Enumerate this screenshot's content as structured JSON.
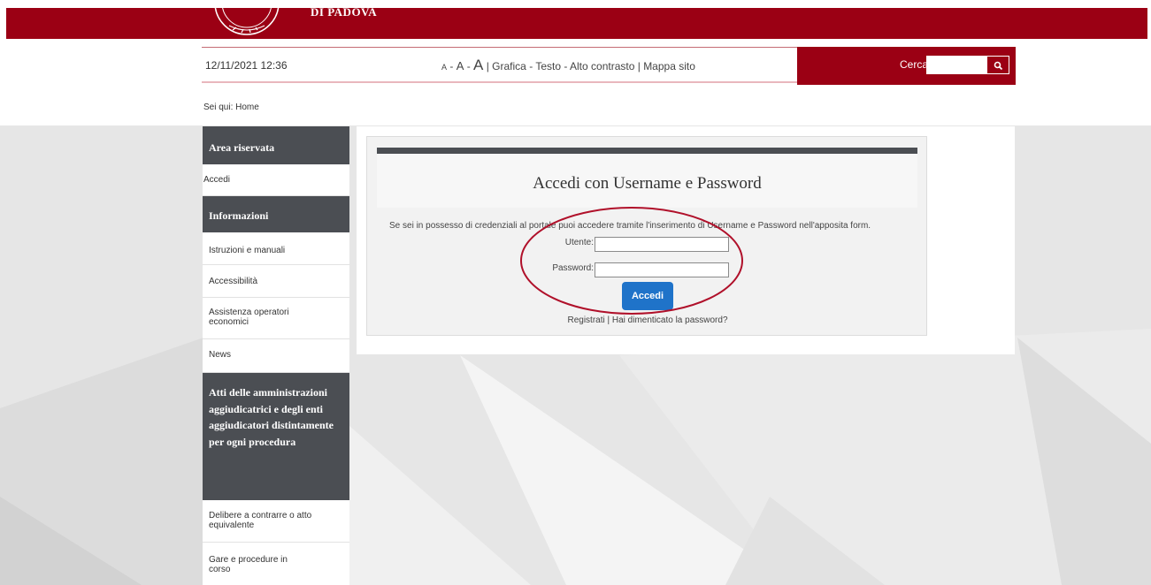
{
  "banner": {
    "logo_text": "DI PADOVA",
    "bg_color": "#9b0014"
  },
  "utility_bar": {
    "datetime": "12/11/2021 12:36",
    "font_small": "A",
    "sep1": " - ",
    "font_medium": "A",
    "sep2": " - ",
    "font_large": "A",
    "sep3": " | ",
    "grafica": "Grafica",
    "sep4": " - ",
    "testo": "Testo",
    "sep5": " - ",
    "alto_contrasto": "Alto contrasto",
    "sep6": " | ",
    "mappa_sito": "Mappa sito",
    "search_label": "Cerca:",
    "search_value": "",
    "search_icon": "search-icon"
  },
  "breadcrumb": {
    "prefix": "Sei qui:",
    "current": "Home"
  },
  "sidebar": {
    "sections": [
      {
        "title": "Area riservata",
        "items": [
          "Accedi"
        ]
      },
      {
        "title": "Informazioni",
        "items": [
          "Istruzioni e manuali",
          "Accessibilità",
          "Assistenza operatori economici",
          "News"
        ]
      },
      {
        "title": "Atti delle amministrazioni aggiudicatrici e degli enti aggiudicatori distintamente per ogni procedura",
        "items": [
          "Delibere a contrarre o atto equivalente",
          "Gare e procedure in corso"
        ]
      }
    ]
  },
  "login": {
    "title": "Accedi con Username e Password",
    "description": "Se sei in possesso di credenziali al portale puoi accedere tramite l'inserimento di Username e Password nell'apposita form.",
    "username_label": "Utente:",
    "username_value": "",
    "password_label": "Password:",
    "password_value": "",
    "submit_label": "Accedi",
    "register_link": "Registrati",
    "links_separator": " | ",
    "forgot_link": "Hai dimenticato la password?"
  },
  "colors": {
    "brand": "#9b0014",
    "sidebar_header": "#4b4e53",
    "button": "#1f73c9",
    "highlight": "#b0102a"
  }
}
